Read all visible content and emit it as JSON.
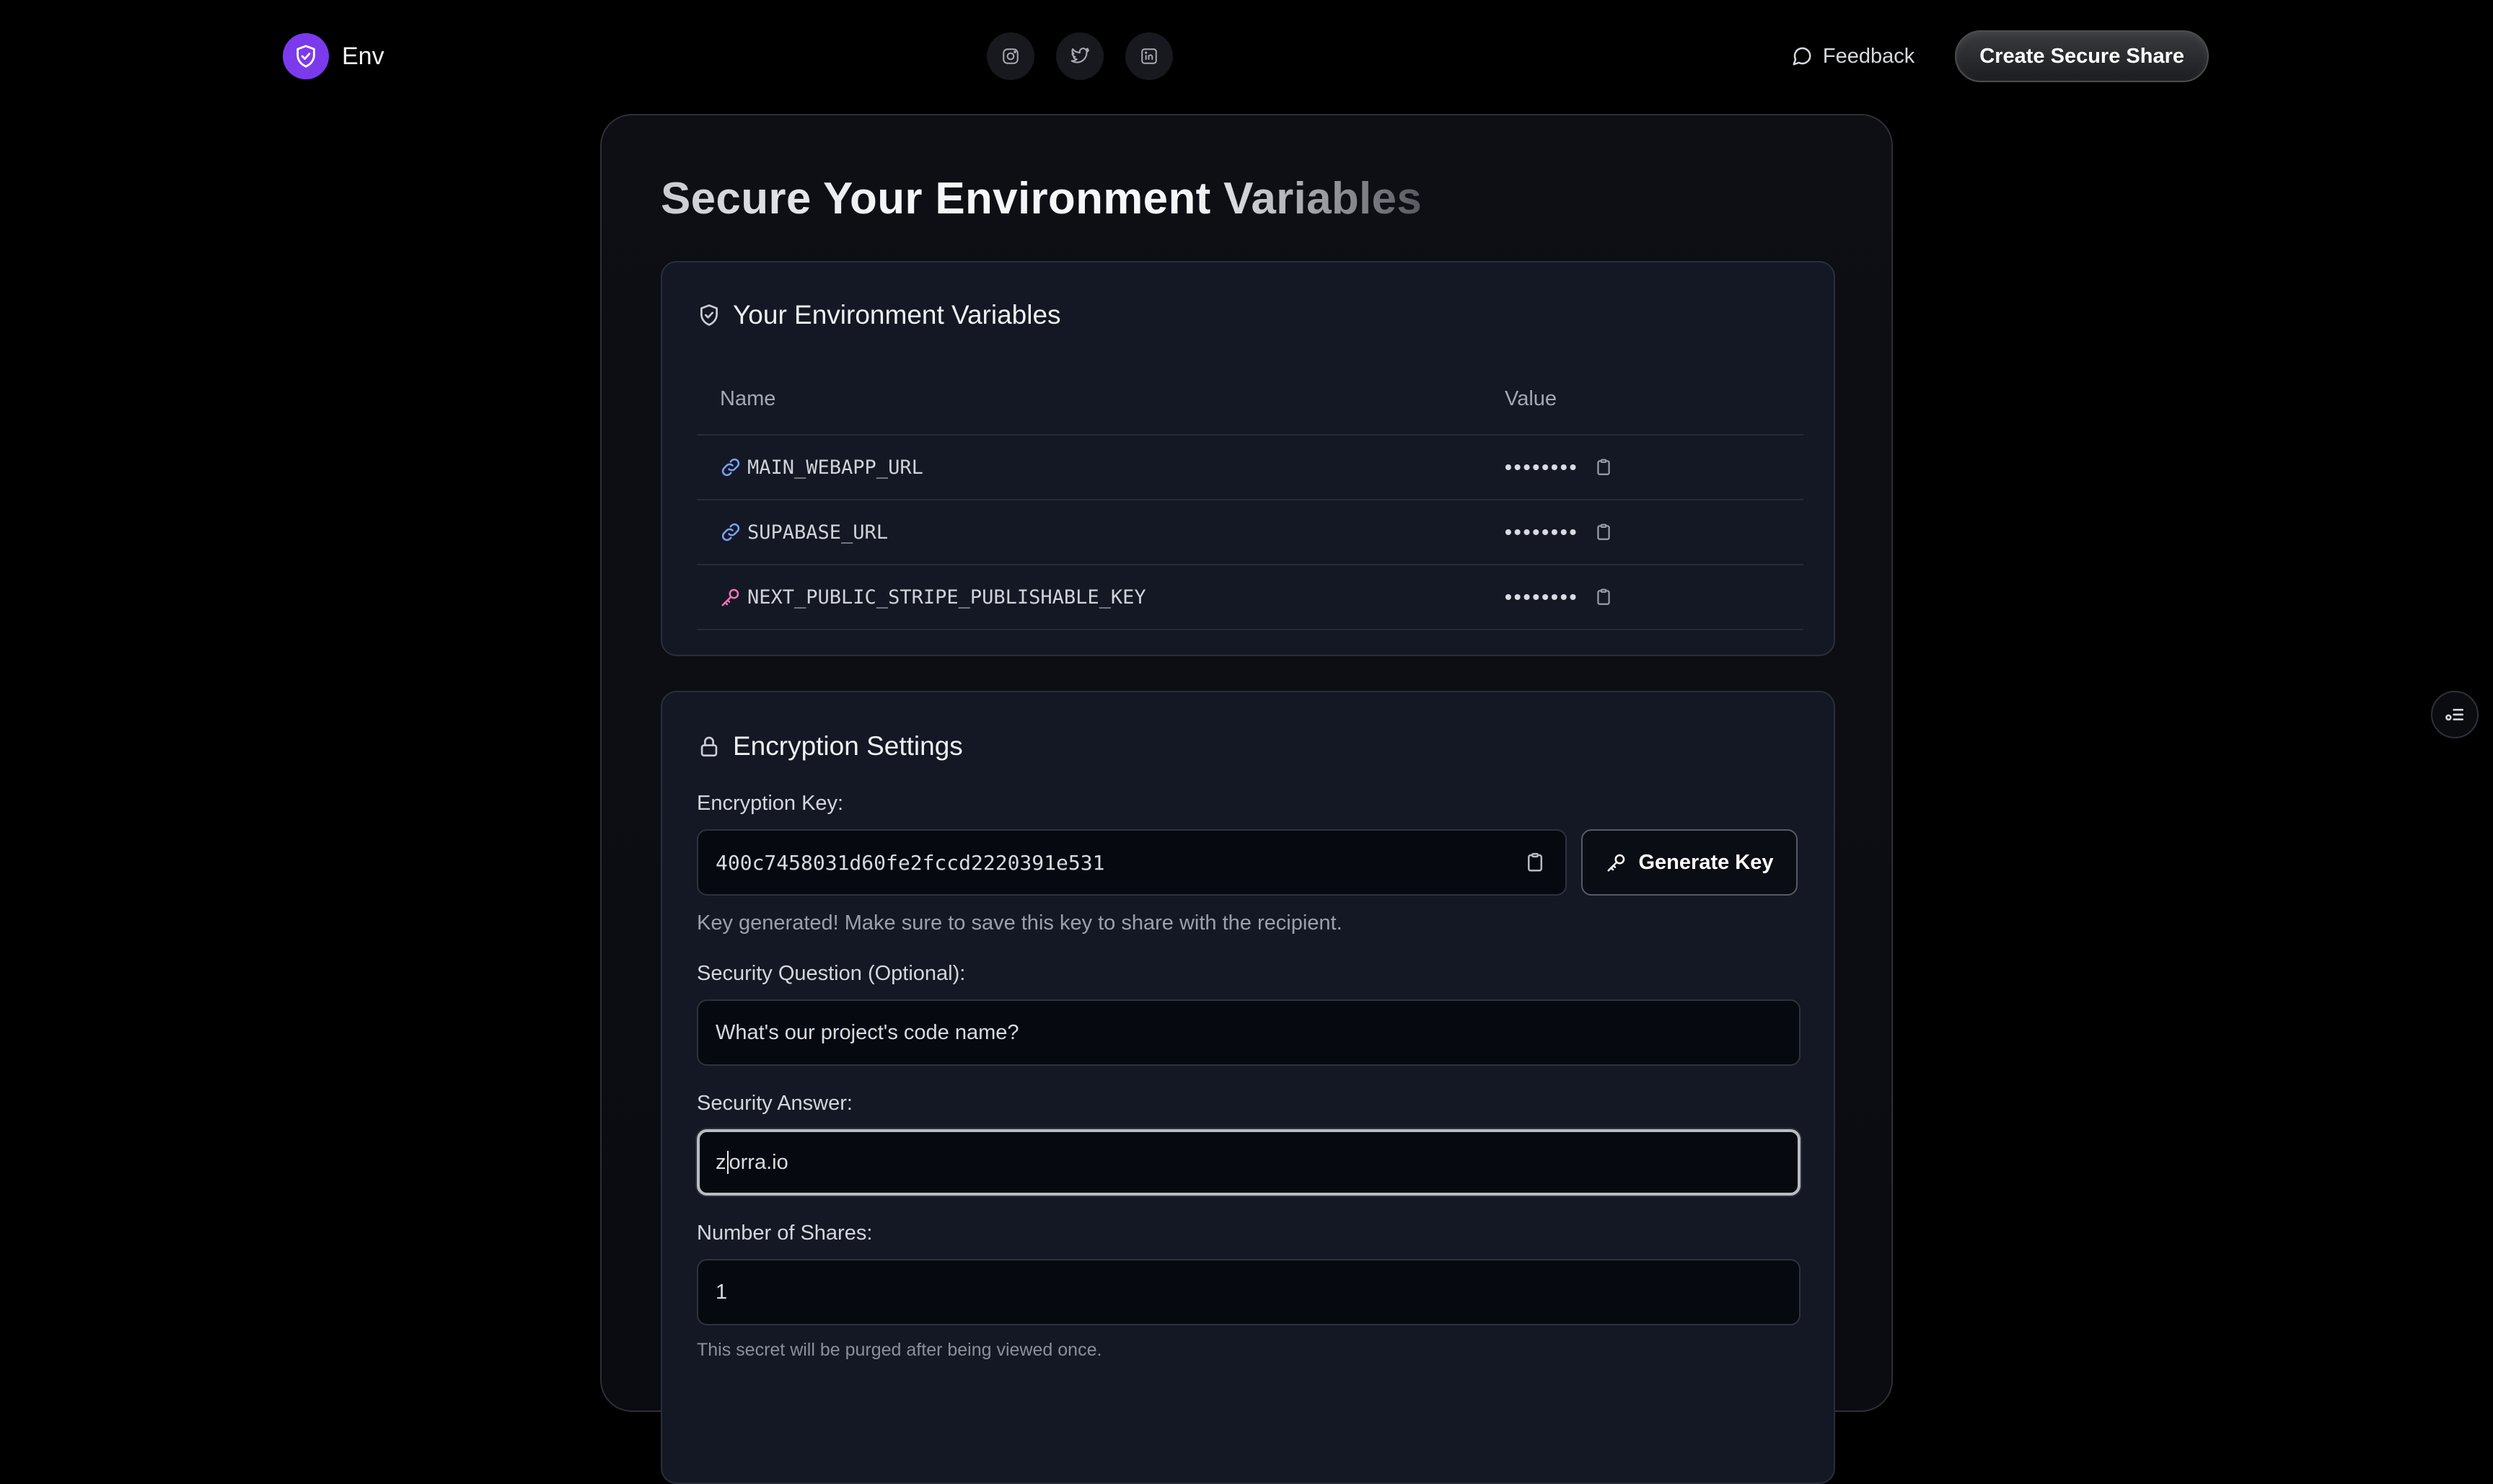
{
  "nav": {
    "brand_name": "Env",
    "brand_color": "#7c3aed",
    "socials": [
      {
        "icon": "instagram-icon"
      },
      {
        "icon": "twitter-icon"
      },
      {
        "icon": "linkedin-icon"
      }
    ],
    "feedback_label": "Feedback",
    "cta_label": "Create Secure Share"
  },
  "main": {
    "title": "Secure Your Environment Variables"
  },
  "variables": {
    "heading": "Your Environment Variables",
    "columns": {
      "name": "Name",
      "value": "Value"
    },
    "rows": [
      {
        "name": "MAIN_WEBAPP_URL",
        "value": "••••••••",
        "icon": "link-icon",
        "icon_color": "#7aa2f7"
      },
      {
        "name": "SUPABASE_URL",
        "value": "••••••••",
        "icon": "link-icon",
        "icon_color": "#7aa2f7"
      },
      {
        "name": "NEXT_PUBLIC_STRIPE_PUBLISHABLE_KEY",
        "value": "••••••••",
        "icon": "key-icon",
        "icon_color": "#f472b6"
      }
    ]
  },
  "encryption": {
    "heading": "Encryption Settings",
    "key_label": "Encryption Key:",
    "key_value": "400c7458031d60fe2fccd2220391e531",
    "generate_label": "Generate Key",
    "key_hint": "Key generated! Make sure to save this key to share with the recipient.",
    "question_label": "Security Question (Optional):",
    "question_value": "What's our project's code name?",
    "answer_label": "Security Answer:",
    "answer_value_before_caret": "z",
    "answer_value_after_caret": "orra.io",
    "shares_label": "Number of Shares:",
    "shares_value": "1",
    "shares_hint": "This secret will be purged after being viewed once."
  }
}
